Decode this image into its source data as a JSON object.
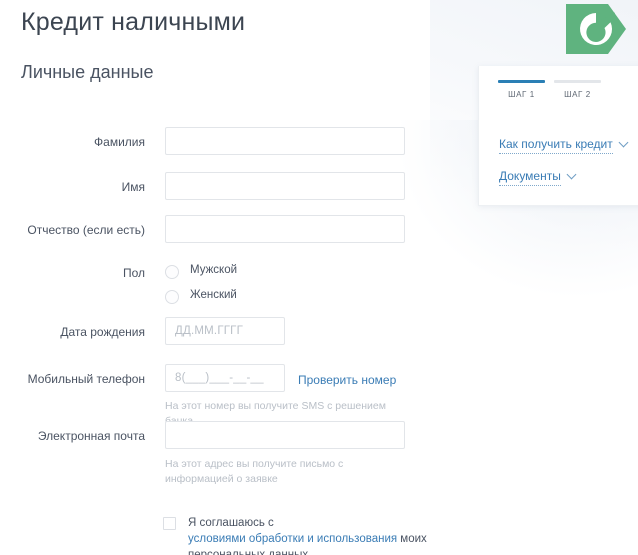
{
  "page": {
    "title": "Кредит наличными",
    "section_title": "Личные данные",
    "accent_blue": "#3a7cb5",
    "tab_active_color": "#2a7fb5",
    "logo_green": "#5fb37f"
  },
  "form": {
    "fields": [
      {
        "label": "Фамилия",
        "value": "",
        "placeholder": ""
      },
      {
        "label": "Имя",
        "value": "",
        "placeholder": ""
      },
      {
        "label": "Отчество (если есть)",
        "value": "",
        "placeholder": ""
      }
    ],
    "gender": {
      "label": "Пол",
      "options": [
        {
          "label": "Мужской",
          "selected": false
        },
        {
          "label": "Женский",
          "selected": false
        }
      ]
    },
    "birth_date": {
      "label": "Дата рождения",
      "placeholder": "ДД.ММ.ГГГГ",
      "value": ""
    },
    "phone": {
      "label": "Мобильный телефон",
      "placeholder": "8(___)___-__-__",
      "value": "",
      "action_link": "Проверить номер",
      "hint": "На этот номер вы получите SMS с решением банка"
    },
    "email": {
      "label": "Электронная почта",
      "placeholder": "",
      "value": "",
      "hint": "На этот адрес вы получите письмо с информацией о заявке"
    },
    "consent": {
      "checked": false,
      "text_before": "Я соглашаюсь с ",
      "link_text": "условиями обработки и использования",
      "text_after": " моих персональных данных"
    }
  },
  "panel": {
    "tabs": [
      {
        "label": "ШАГ 1",
        "active": true
      },
      {
        "label": "ШАГ 2",
        "active": false
      }
    ],
    "links": [
      {
        "label": "Как получить кредит",
        "icon": "chevron-down-icon"
      },
      {
        "label": "Документы",
        "icon": "chevron-down-icon"
      }
    ]
  },
  "logo": {
    "name": "sberbank-logo",
    "letter": "C"
  }
}
